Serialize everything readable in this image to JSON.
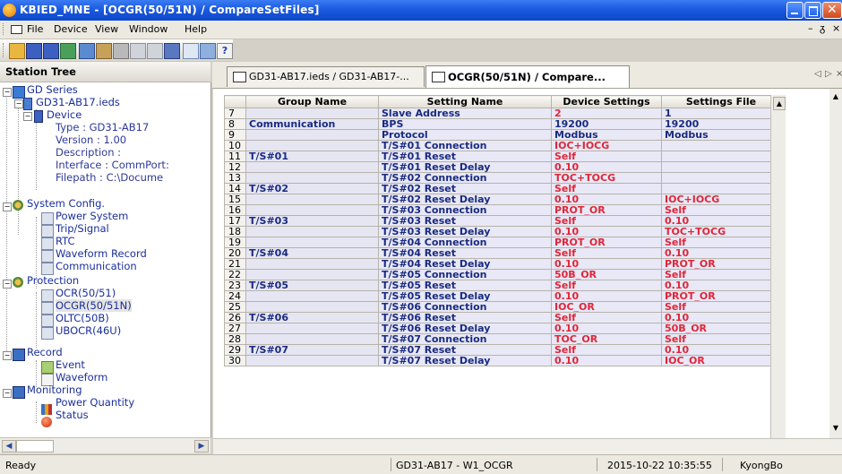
{
  "window": {
    "title": "KBIED_MNE - [OCGR(50/51N) / CompareSetFiles]"
  },
  "menu": {
    "items": [
      "File",
      "Device",
      "View",
      "Window",
      "Help"
    ]
  },
  "station_tree": {
    "header": "Station Tree",
    "root": "GD Series",
    "ied": "GD31-AB17.ieds",
    "device": "Device",
    "type": "Type : GD31-AB17",
    "version": "Version : 1.00",
    "description": "Description :",
    "interface": "Interface : CommPort:",
    "filepath": "Filepath : C:\\Docume",
    "system_config": "System Config.",
    "power_system": "Power System",
    "trip_signal": "Trip/Signal",
    "rtc": "RTC",
    "waveform_record": "Waveform Record",
    "communication": "Communication",
    "protection": "Protection",
    "ocr": "OCR(50/51)",
    "ocgr": "OCGR(50/51N)",
    "oltc": "OLTC(50B)",
    "ubocr": "UBOCR(46U)",
    "record": "Record",
    "event": "Event",
    "waveform": "Waveform",
    "monitoring": "Monitoring",
    "power_quantity": "Power Quantity",
    "status": "Status"
  },
  "tabs": [
    {
      "label": "GD31-AB17.ieds / GD31-AB17-..."
    },
    {
      "label": "OCGR(50/51N) / Compare..."
    }
  ],
  "grid": {
    "headers": {
      "group": "Group Name",
      "setting": "Setting Name",
      "device": "Device Settings",
      "file": "Settings File"
    },
    "rows": [
      {
        "n": "7",
        "group": "",
        "setting": "Slave Address",
        "device": "2",
        "file": "1"
      },
      {
        "n": "8",
        "group": "Communication",
        "setting": "BPS",
        "device": "19200",
        "file": "19200"
      },
      {
        "n": "9",
        "group": "",
        "setting": "Protocol",
        "device": "Modbus",
        "file": "Modbus"
      },
      {
        "n": "10",
        "group": "",
        "setting": "T/S#01 Connection",
        "device": "IOC+IOCG",
        "file": ""
      },
      {
        "n": "11",
        "group": "T/S#01",
        "setting": "T/S#01 Reset",
        "device": "Self",
        "file": ""
      },
      {
        "n": "12",
        "group": "",
        "setting": "T/S#01 Reset Delay",
        "device": "0.10",
        "file": ""
      },
      {
        "n": "13",
        "group": "",
        "setting": "T/S#02 Connection",
        "device": "TOC+TOCG",
        "file": ""
      },
      {
        "n": "14",
        "group": "T/S#02",
        "setting": "T/S#02 Reset",
        "device": "Self",
        "file": ""
      },
      {
        "n": "15",
        "group": "",
        "setting": "T/S#02 Reset Delay",
        "device": "0.10",
        "file": "IOC+IOCG"
      },
      {
        "n": "16",
        "group": "",
        "setting": "T/S#03 Connection",
        "device": "PROT_OR",
        "file": "Self"
      },
      {
        "n": "17",
        "group": "T/S#03",
        "setting": "T/S#03 Reset",
        "device": "Self",
        "file": "0.10"
      },
      {
        "n": "18",
        "group": "",
        "setting": "T/S#03 Reset Delay",
        "device": "0.10",
        "file": "TOC+TOCG"
      },
      {
        "n": "19",
        "group": "",
        "setting": "T/S#04 Connection",
        "device": "PROT_OR",
        "file": "Self"
      },
      {
        "n": "20",
        "group": "T/S#04",
        "setting": "T/S#04 Reset",
        "device": "Self",
        "file": "0.10"
      },
      {
        "n": "21",
        "group": "",
        "setting": "T/S#04 Reset Delay",
        "device": "0.10",
        "file": "PROT_OR"
      },
      {
        "n": "22",
        "group": "",
        "setting": "T/S#05 Connection",
        "device": "50B_OR",
        "file": "Self"
      },
      {
        "n": "23",
        "group": "T/S#05",
        "setting": "T/S#05 Reset",
        "device": "Self",
        "file": "0.10"
      },
      {
        "n": "24",
        "group": "",
        "setting": "T/S#05 Reset Delay",
        "device": "0.10",
        "file": "PROT_OR"
      },
      {
        "n": "25",
        "group": "",
        "setting": "T/S#06 Connection",
        "device": "IOC_OR",
        "file": "Self"
      },
      {
        "n": "26",
        "group": "T/S#06",
        "setting": "T/S#06 Reset",
        "device": "Self",
        "file": "0.10"
      },
      {
        "n": "27",
        "group": "",
        "setting": "T/S#06 Reset Delay",
        "device": "0.10",
        "file": "50B_OR"
      },
      {
        "n": "28",
        "group": "",
        "setting": "T/S#07 Connection",
        "device": "TOC_OR",
        "file": "Self"
      },
      {
        "n": "29",
        "group": "T/S#07",
        "setting": "T/S#07 Reset",
        "device": "Self",
        "file": "0.10"
      },
      {
        "n": "30",
        "group": "",
        "setting": "T/S#07 Reset Delay",
        "device": "0.10",
        "file": "IOC_OR"
      }
    ],
    "dark_value_rows": [
      0,
      1,
      2
    ]
  },
  "status": {
    "ready": "Ready",
    "station": "GD31-AB17 - W1_OCGR",
    "datetime": "2015-10-22 10:35:55",
    "company": "KyongBo"
  }
}
